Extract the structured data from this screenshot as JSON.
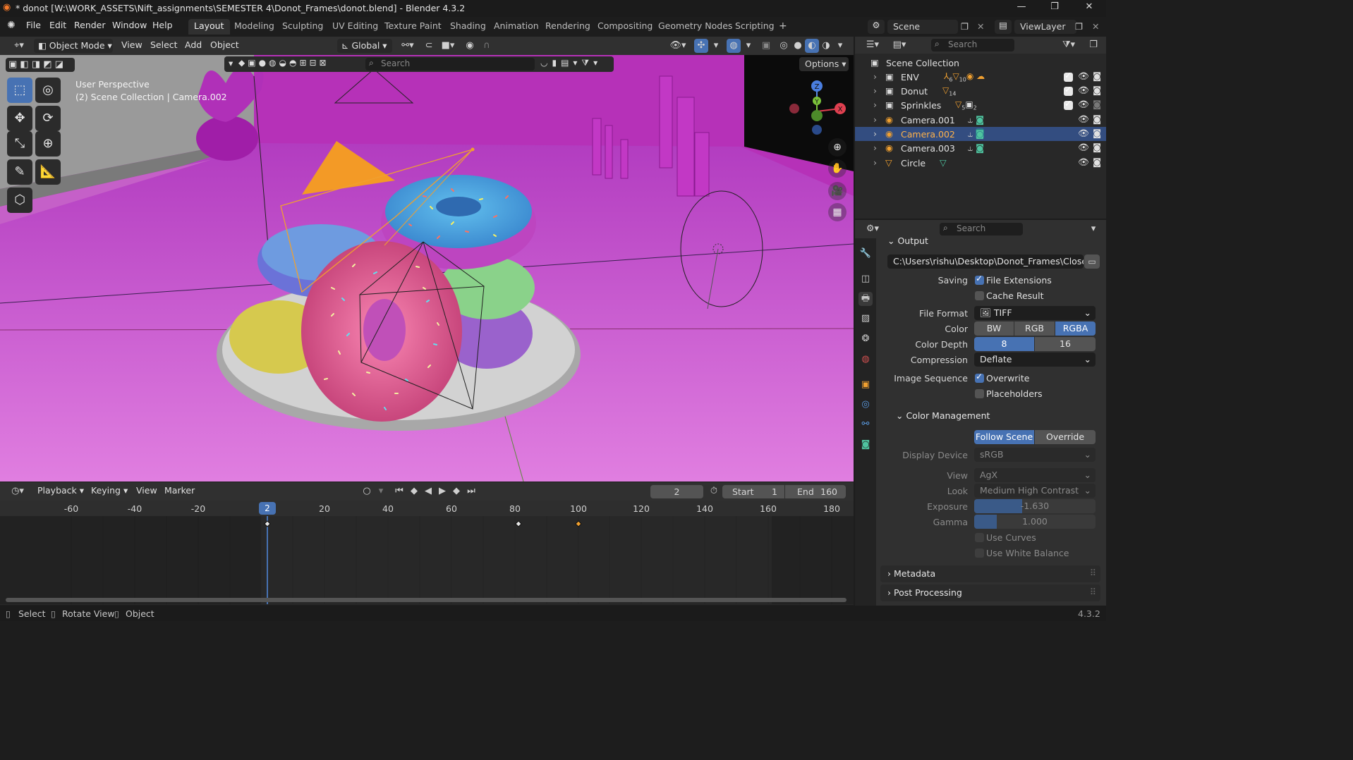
{
  "window": {
    "title": "* donot [W:\\WORK_ASSETS\\Nift_assignments\\SEMESTER 4\\Donot_Frames\\donot.blend] - Blender 4.3.2",
    "minimize": "—",
    "maximize": "❐",
    "close": "✕"
  },
  "menubar": {
    "items": [
      "File",
      "Edit",
      "Render",
      "Window",
      "Help"
    ],
    "workspaces": [
      "Layout",
      "Modeling",
      "Sculpting",
      "UV Editing",
      "Texture Paint",
      "Shading",
      "Animation",
      "Rendering",
      "Compositing",
      "Geometry Nodes",
      "Scripting"
    ],
    "active_workspace": "Layout",
    "add_tab": "+",
    "scene": "Scene",
    "view_layer": "ViewLayer"
  },
  "viewport_header": {
    "mode": "Object Mode",
    "menus": [
      "View",
      "Select",
      "Add",
      "Object"
    ],
    "transform_orientation": "Global",
    "search_placeholder": "Search",
    "options": "Options"
  },
  "viewport": {
    "perspective": "User Perspective",
    "collection_info": "(2) Scene Collection | Camera.002",
    "gizmo": {
      "z": "Z",
      "y": "Y",
      "x": "X"
    }
  },
  "timeline": {
    "menus": [
      "Playback",
      "Keying",
      "View",
      "Marker"
    ],
    "current_frame": "2",
    "start_label": "Start",
    "start": "1",
    "end_label": "End",
    "end": "160",
    "ruler": [
      "-60",
      "-40",
      "-20",
      "20",
      "40",
      "60",
      "80",
      "100",
      "120",
      "140",
      "160",
      "180"
    ],
    "playhead": "2"
  },
  "outliner": {
    "search_placeholder": "Search",
    "root": "Scene Collection",
    "items": [
      {
        "name": "ENV",
        "type": "collection"
      },
      {
        "name": "Donut",
        "type": "collection"
      },
      {
        "name": "Sprinkles",
        "type": "collection"
      },
      {
        "name": "Camera.001",
        "type": "camera"
      },
      {
        "name": "Camera.002",
        "type": "camera"
      },
      {
        "name": "Camera.003",
        "type": "camera"
      },
      {
        "name": "Circle",
        "type": "mesh"
      }
    ],
    "badges": {
      "env_a": "6",
      "env_b": "10",
      "donut": "14",
      "sprinkles_a": "5",
      "sprinkles_b": "2"
    }
  },
  "properties": {
    "search_placeholder": "Search",
    "output_section": "Output",
    "output_path": "C:\\Users\\rishu\\Desktop\\Donot_Frames\\Closeup...",
    "saving_label": "Saving",
    "file_extensions": "File Extensions",
    "cache_result": "Cache Result",
    "file_format_label": "File Format",
    "file_format": "TIFF",
    "color_label": "Color",
    "color_options": [
      "BW",
      "RGB",
      "RGBA"
    ],
    "color_selected": "RGBA",
    "color_depth_label": "Color Depth",
    "color_depth_options": [
      "8",
      "16"
    ],
    "color_depth_selected": "8",
    "compression_label": "Compression",
    "compression": "Deflate",
    "image_sequence_label": "Image Sequence",
    "overwrite": "Overwrite",
    "placeholders": "Placeholders",
    "color_management": "Color Management",
    "follow_scene": "Follow Scene",
    "override": "Override",
    "display_device_label": "Display Device",
    "display_device": "sRGB",
    "view_label": "View",
    "view": "AgX",
    "look_label": "Look",
    "look": "Medium High Contrast",
    "exposure_label": "Exposure",
    "exposure": "-1.630",
    "gamma_label": "Gamma",
    "gamma": "1.000",
    "use_curves": "Use Curves",
    "use_white_balance": "Use White Balance",
    "metadata": "Metadata",
    "post_processing": "Post Processing"
  },
  "statusbar": {
    "select": "Select",
    "rotate": "Rotate View",
    "object": "Object",
    "version": "4.3.2"
  },
  "colors": {
    "accent": "#4772b3",
    "selection": "#334d80",
    "camera_orange": "#e8913a",
    "scene_magenta": "#c43ec8"
  }
}
